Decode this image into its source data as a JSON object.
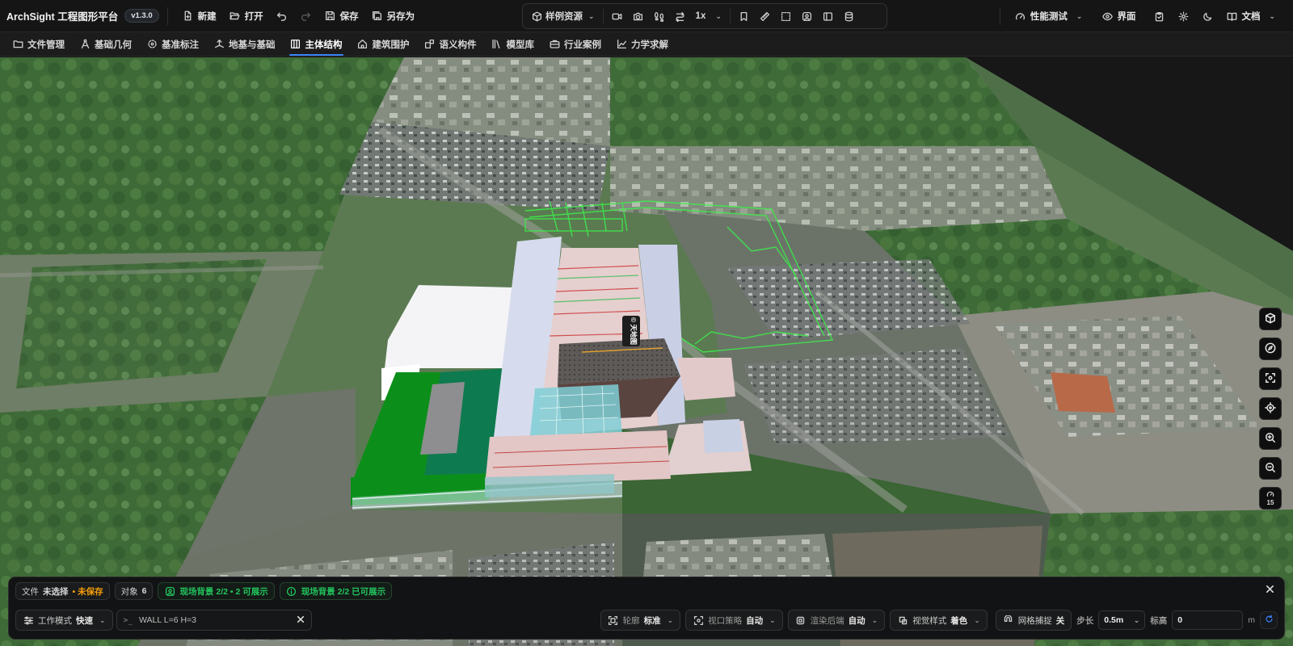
{
  "app": {
    "title": "ArchSight 工程图形平台",
    "version": "v1.3.0"
  },
  "toolbar": {
    "new_label": "新建",
    "open_label": "打开",
    "save_label": "保存",
    "save_as_label": "另存为"
  },
  "center": {
    "resources_label": "样例资源",
    "speed_label": "1x"
  },
  "right": {
    "perf_label": "性能测试",
    "ui_label": "界面",
    "docs_label": "文档"
  },
  "nav": {
    "items": [
      {
        "label": "文件管理"
      },
      {
        "label": "基础几何"
      },
      {
        "label": "基准标注"
      },
      {
        "label": "地基与基础"
      },
      {
        "label": "主体结构"
      },
      {
        "label": "建筑围护"
      },
      {
        "label": "语义构件"
      },
      {
        "label": "模型库"
      },
      {
        "label": "行业案例"
      },
      {
        "label": "力学求解"
      }
    ],
    "active": "主体结构"
  },
  "viewport": {
    "watermark": "© 天地图",
    "fps": "15"
  },
  "status": {
    "file_key": "文件",
    "file_value": "未选择",
    "unsaved": "• 未保存",
    "objects_key": "对象",
    "objects_value": "6",
    "scene_bg_1": "现场背景 2/2 • 2 可展示",
    "scene_bg_2": "现场背景 2/2 已可展示"
  },
  "controls": {
    "work_mode_key": "工作模式",
    "work_mode_value": "快速",
    "command_value": "WALL L=6 H=3",
    "outline_key": "轮廓",
    "outline_value": "标准",
    "viewport_policy_key": "视口策略",
    "viewport_policy_value": "自动",
    "render_backend_key": "渲染后端",
    "render_backend_value": "自动",
    "visual_style_key": "视觉样式",
    "visual_style_value": "着色",
    "grid_snap_key": "网格捕捉",
    "grid_snap_value": "关",
    "step_label": "步长",
    "step_value": "0.5m",
    "elevation_label": "标高",
    "elevation_value": "0",
    "unit": "m"
  },
  "colors": {
    "accent": "#3b82f6",
    "success": "#22c55e",
    "warning": "#f59e0b"
  }
}
